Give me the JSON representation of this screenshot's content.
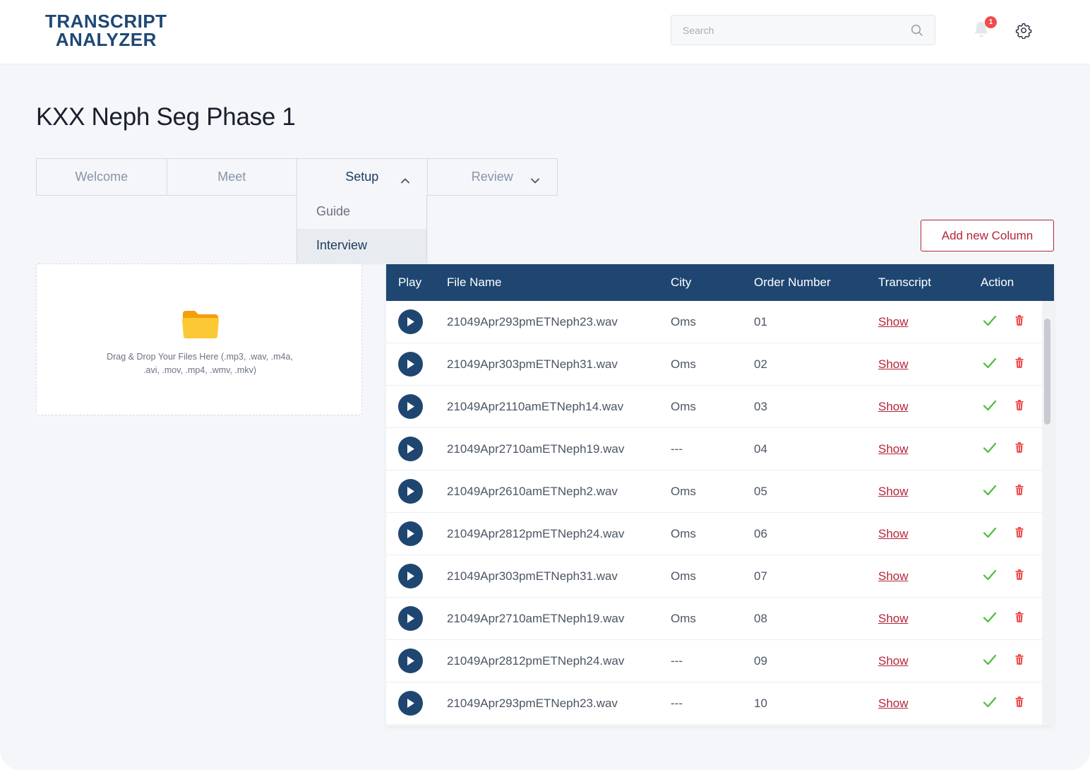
{
  "app": {
    "logo_line1": "TRANSCRIPT",
    "logo_line2": "ANALYZER"
  },
  "header": {
    "search_placeholder": "Search",
    "notification_count": "1",
    "icons": [
      "search-icon",
      "bell-icon",
      "gear-icon"
    ]
  },
  "page": {
    "title": "KXX Neph Seg Phase 1"
  },
  "tabs": [
    {
      "label": "Welcome"
    },
    {
      "label": "Meet"
    },
    {
      "label": "Setup",
      "state": "expanded"
    },
    {
      "label": "Review",
      "state": "collapsed"
    }
  ],
  "setup_dropdown": {
    "items": [
      "Guide",
      "Interview"
    ],
    "selected": "Interview"
  },
  "actions": {
    "add_column_label": "Add new Column"
  },
  "dropzone": {
    "text": "Drag & Drop Your Files Here (.mp3, .wav, .m4a, .avi, .mov, .mp4, .wmv, .mkv)",
    "icon": "folder-icon"
  },
  "table": {
    "columns": [
      "Play",
      "File Name",
      "City",
      "Order Number",
      "Transcript",
      "Action"
    ],
    "rows": [
      {
        "file": "21049Apr293pmETNeph23.wav",
        "city": "Oms",
        "order": "01",
        "transcript": "Show"
      },
      {
        "file": "21049Apr303pmETNeph31.wav",
        "city": "Oms",
        "order": "02",
        "transcript": "Show"
      },
      {
        "file": "21049Apr2110amETNeph14.wav",
        "city": "Oms",
        "order": "03",
        "transcript": "Show"
      },
      {
        "file": "21049Apr2710amETNeph19.wav",
        "city": "---",
        "order": "04",
        "transcript": "Show"
      },
      {
        "file": "21049Apr2610amETNeph2.wav",
        "city": "Oms",
        "order": "05",
        "transcript": "Show"
      },
      {
        "file": "21049Apr2812pmETNeph24.wav",
        "city": "Oms",
        "order": "06",
        "transcript": "Show"
      },
      {
        "file": "21049Apr303pmETNeph31.wav",
        "city": "Oms",
        "order": "07",
        "transcript": "Show"
      },
      {
        "file": "21049Apr2710amETNeph19.wav",
        "city": "Oms",
        "order": "08",
        "transcript": "Show"
      },
      {
        "file": "21049Apr2812pmETNeph24.wav",
        "city": "---",
        "order": "09",
        "transcript": "Show"
      },
      {
        "file": "21049Apr293pmETNeph23.wav",
        "city": "---",
        "order": "10",
        "transcript": "Show"
      }
    ]
  },
  "colors": {
    "primary": "#1e4670",
    "accent": "#b3263a",
    "success": "#4cbb3c",
    "danger": "#ef4b4b",
    "folder": "#fbbf24"
  }
}
